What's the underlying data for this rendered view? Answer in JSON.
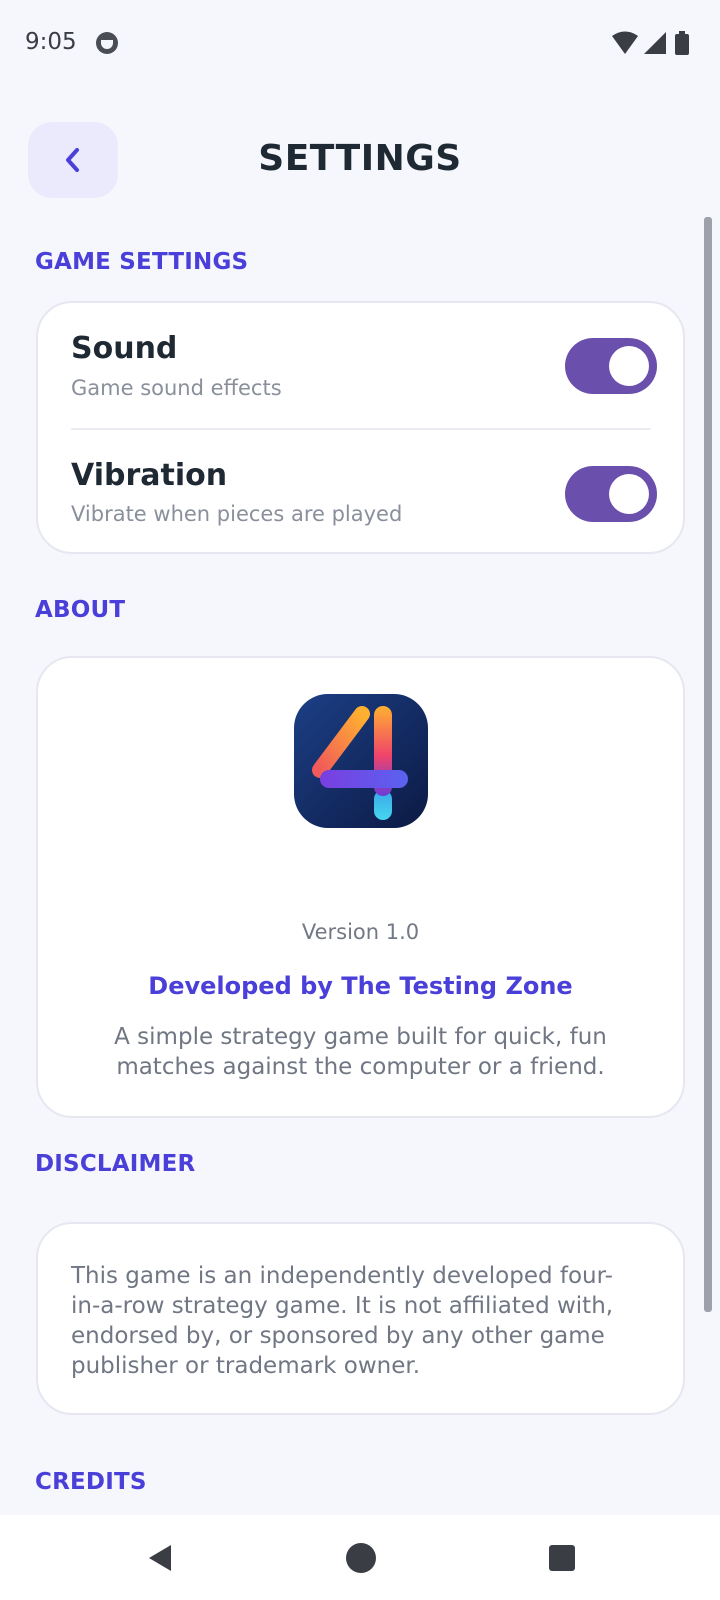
{
  "status_bar": {
    "time": "9:05",
    "icons": [
      "app-notification-icon",
      "wifi-icon",
      "signal-icon",
      "battery-icon"
    ]
  },
  "header": {
    "back_icon": "chevron-left-icon",
    "title": "SETTINGS"
  },
  "game_settings": {
    "label": "GAME SETTINGS",
    "items": [
      {
        "title": "Sound",
        "subtitle": "Game sound effects",
        "enabled": true
      },
      {
        "title": "Vibration",
        "subtitle": "Vibrate when pieces are played",
        "enabled": true
      }
    ]
  },
  "about": {
    "label": "ABOUT",
    "logo_icon": "app-logo-four-icon",
    "version": "Version 1.0",
    "developer": "Developed by The Testing Zone",
    "description": "A simple strategy game built for quick, fun matches against the computer or a friend."
  },
  "disclaimer": {
    "label": "DISCLAIMER",
    "text": "This game is an independently developed four-in-a-row strategy game. It is not affiliated with, endorsed by, or sponsored by any other game publisher or trademark owner."
  },
  "credits": {
    "label": "CREDITS"
  },
  "nav_bar": {
    "icons": [
      "nav-back-icon",
      "nav-home-icon",
      "nav-recents-icon"
    ]
  },
  "colors": {
    "accent": "#4a3fd8",
    "toggle_on": "#6a4fad",
    "background": "#f6f7fc"
  }
}
